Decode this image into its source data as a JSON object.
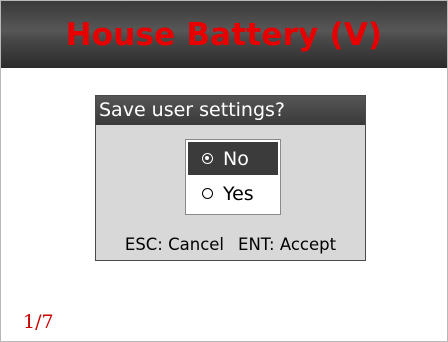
{
  "header": {
    "title": "House Battery (V)"
  },
  "dialog": {
    "title": "Save user settings?",
    "options": [
      {
        "label": "No",
        "selected": true
      },
      {
        "label": "Yes",
        "selected": false
      }
    ],
    "footer": {
      "cancel_hint": "ESC: Cancel",
      "accept_hint": "ENT: Accept"
    }
  },
  "page_indicator": "1/7",
  "colors": {
    "title_red": "#e80000",
    "page_indicator_red": "#cc0000",
    "selected_option_bg": "#3b3b3b",
    "dialog_bg": "#d8d8d8"
  },
  "icons": {
    "selected": "radio-selected-icon",
    "unselected": "radio-unselected-icon"
  }
}
